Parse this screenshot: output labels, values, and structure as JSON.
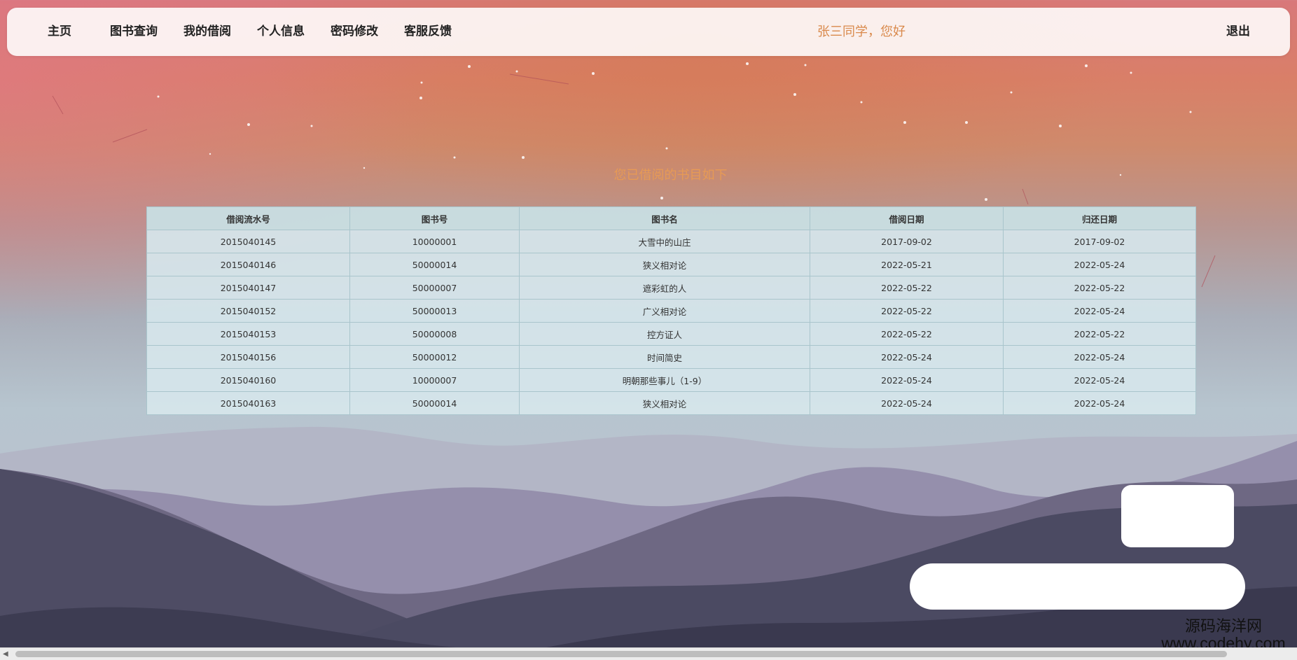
{
  "nav": {
    "items": [
      "主页",
      "图书查询",
      "我的借阅",
      "个人信息",
      "密码修改",
      "客服反馈"
    ],
    "greeting": "张三同学，您好",
    "logout": "退出"
  },
  "main": {
    "heading": "您已借阅的书目如下",
    "table": {
      "headers": [
        "借阅流水号",
        "图书号",
        "图书名",
        "借阅日期",
        "归还日期"
      ],
      "rows": [
        [
          "2015040145",
          "10000001",
          "大雪中的山庄",
          "2017-09-02",
          "2017-09-02"
        ],
        [
          "2015040146",
          "50000014",
          "狭义相对论",
          "2022-05-21",
          "2022-05-24"
        ],
        [
          "2015040147",
          "50000007",
          "遮彩虹的人",
          "2022-05-22",
          "2022-05-22"
        ],
        [
          "2015040152",
          "50000013",
          "广义相对论",
          "2022-05-22",
          "2022-05-24"
        ],
        [
          "2015040153",
          "50000008",
          "控方证人",
          "2022-05-22",
          "2022-05-22"
        ],
        [
          "2015040156",
          "50000012",
          "时间简史",
          "2022-05-24",
          "2022-05-24"
        ],
        [
          "2015040160",
          "10000007",
          "明朝那些事儿（1-9）",
          "2022-05-24",
          "2022-05-24"
        ],
        [
          "2015040163",
          "50000014",
          "狭义相对论",
          "2022-05-24",
          "2022-05-24"
        ]
      ]
    }
  },
  "watermark": {
    "name": "源码海洋网",
    "url": "www.codehy.com"
  },
  "colors": {
    "greeting": "#d9894b",
    "heading": "#e79a55",
    "table_header_bg": "#c8dee3",
    "table_cell_bg": "#d6e6eb",
    "table_border": "#a9c5cc"
  }
}
